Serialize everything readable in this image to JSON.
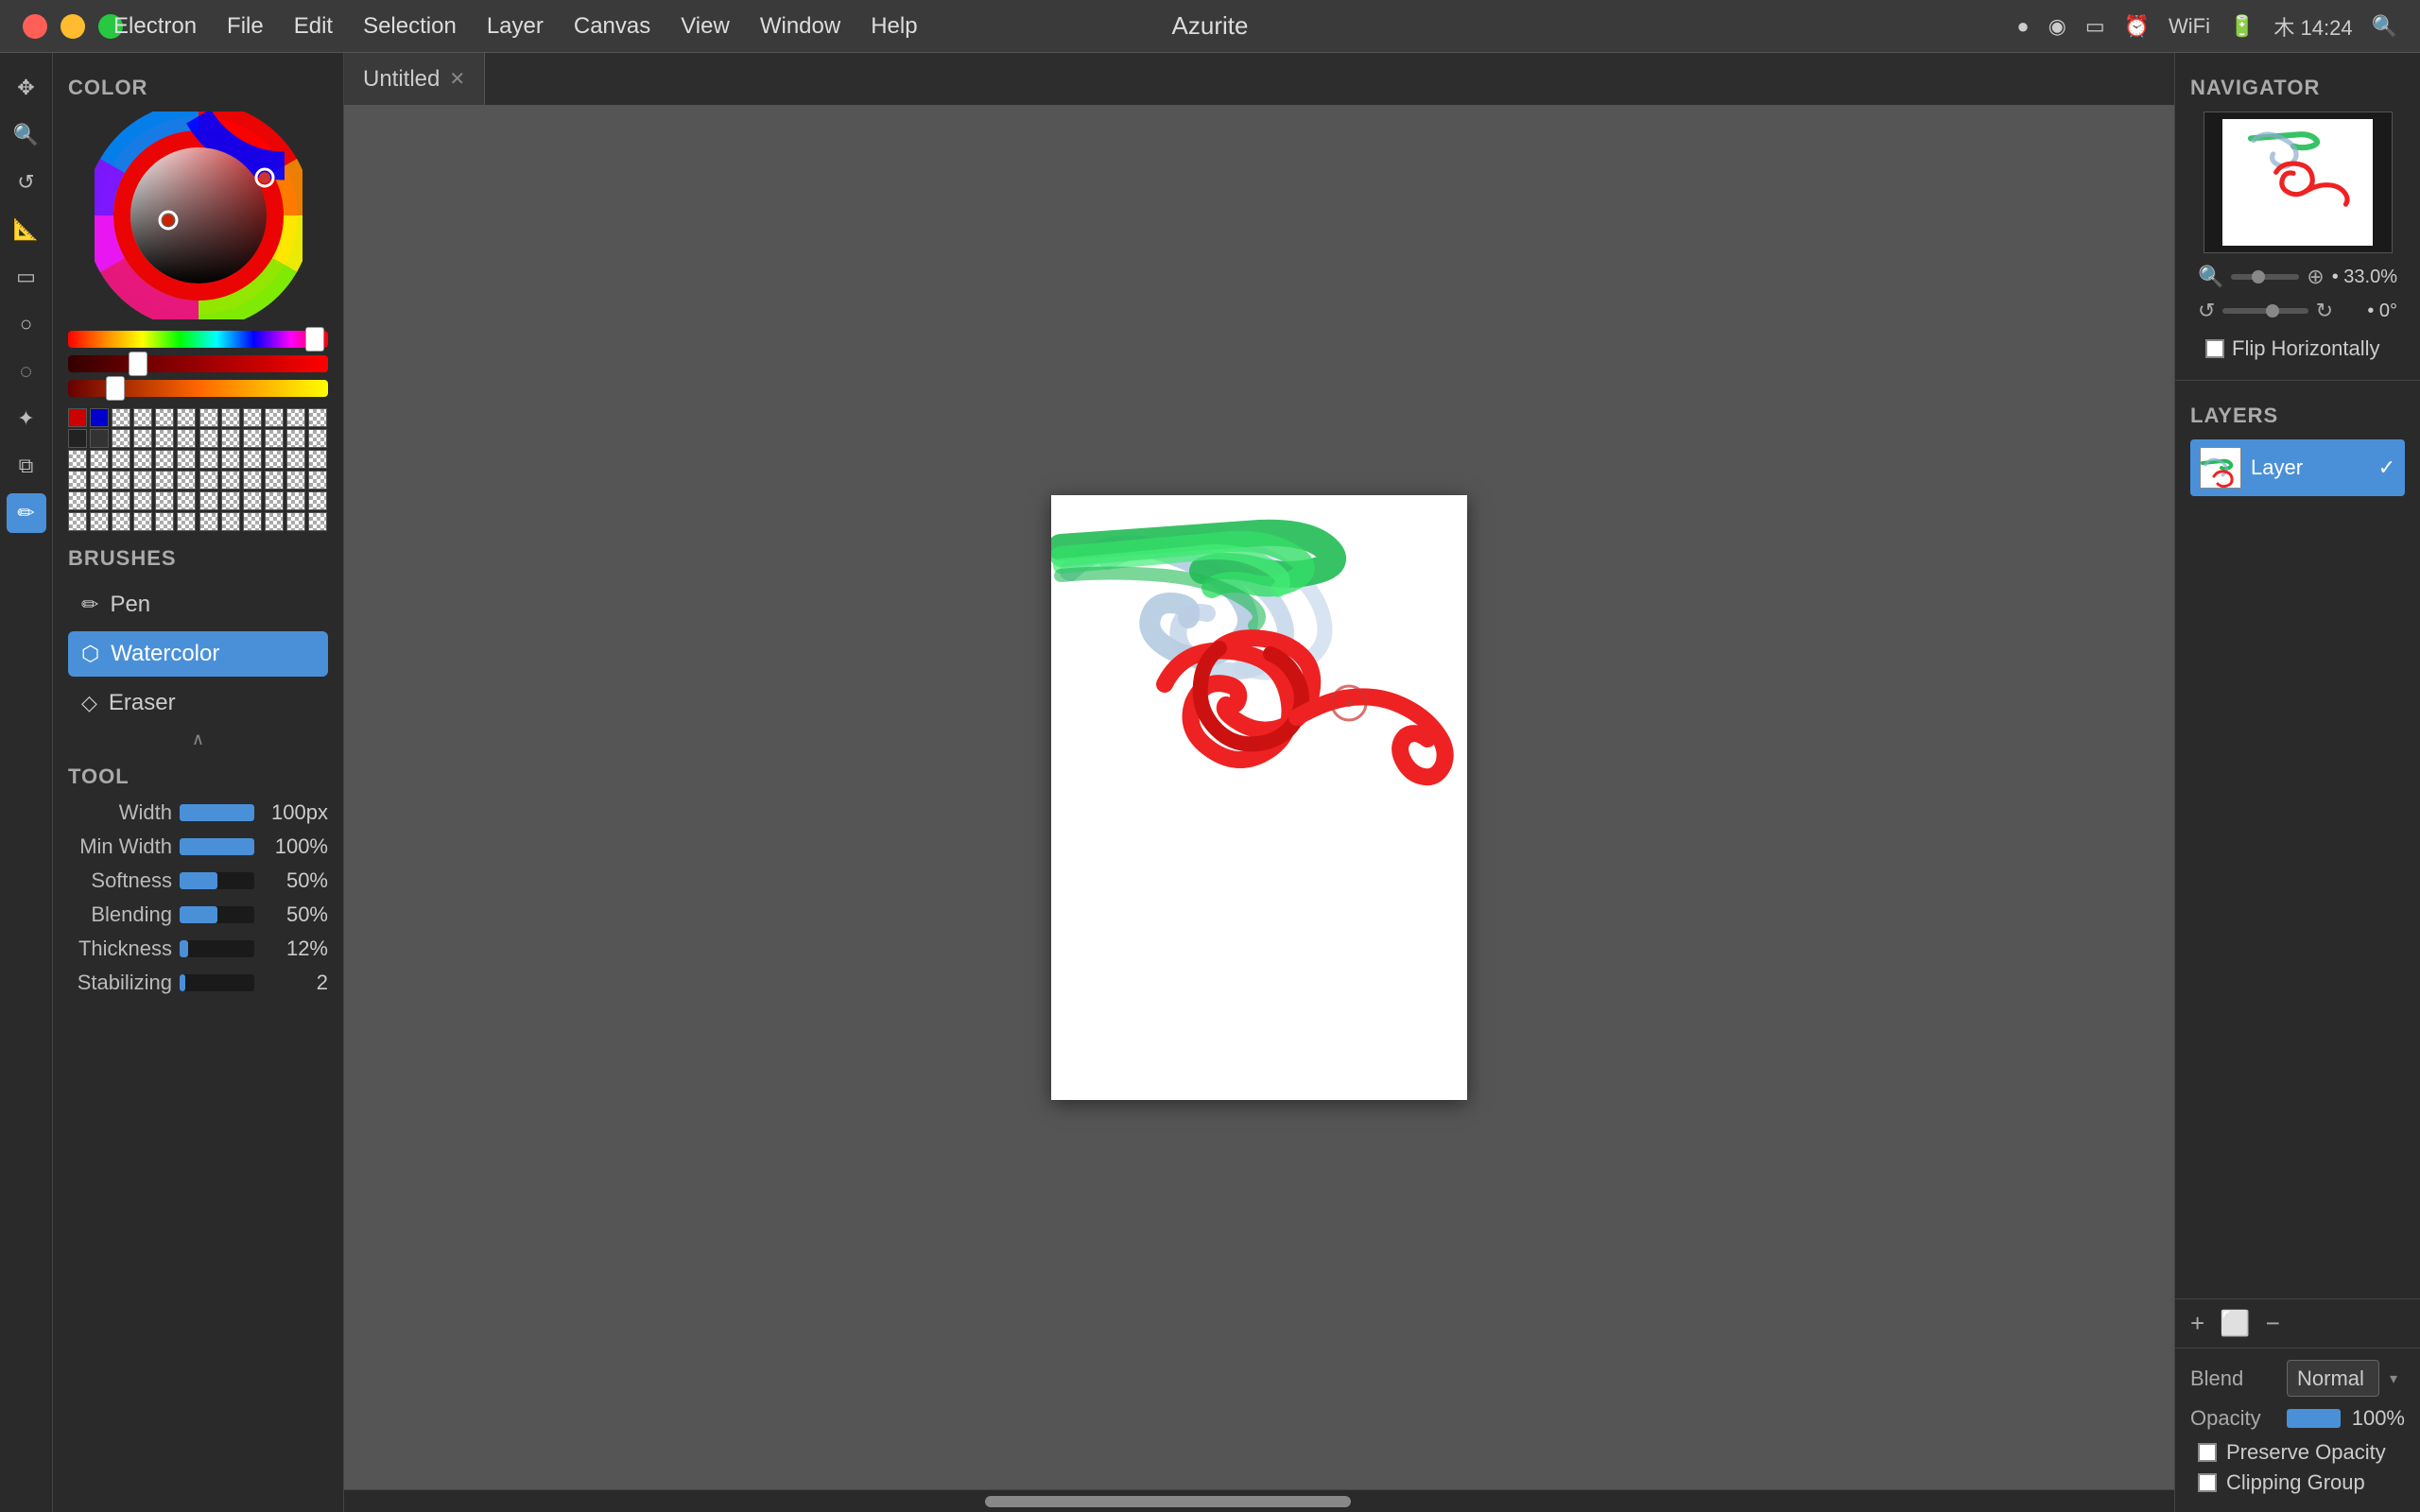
{
  "app": {
    "title": "Azurite",
    "window_title": "Azurite"
  },
  "menu": {
    "items": [
      "Electron",
      "File",
      "Edit",
      "Selection",
      "Layer",
      "Canvas",
      "View",
      "Window",
      "Help"
    ]
  },
  "time": "木 14:24",
  "left_panel": {
    "color_section_title": "COLOR",
    "brushes_section_title": "BRUSHES",
    "tool_section_title": "TOOL",
    "brushes": [
      {
        "name": "Pen",
        "icon": "✏️",
        "active": false
      },
      {
        "name": "Watercolor",
        "icon": "💧",
        "active": true
      },
      {
        "name": "Eraser",
        "icon": "◇",
        "active": false
      }
    ],
    "tool_settings": [
      {
        "label": "Width",
        "value": "100px",
        "percent": 100
      },
      {
        "label": "Min Width",
        "value": "100%",
        "percent": 100
      },
      {
        "label": "Softness",
        "value": "50%",
        "percent": 50
      },
      {
        "label": "Blending",
        "value": "50%",
        "percent": 50
      },
      {
        "label": "Thickness",
        "value": "12%",
        "percent": 12
      },
      {
        "label": "Stabilizing",
        "value": "2",
        "percent": 8
      }
    ]
  },
  "tabs": [
    {
      "name": "Untitled",
      "active": true
    }
  ],
  "navigator": {
    "section_title": "NAVIGATOR",
    "zoom_value": "33.0%",
    "rotation_value": "0°",
    "flip_label": "Flip Horizontally"
  },
  "layers": {
    "section_title": "LAYERS",
    "items": [
      {
        "name": "Layer",
        "visible": true
      }
    ],
    "add_label": "+",
    "group_label": "⬜",
    "delete_label": "−"
  },
  "blend": {
    "blend_label": "Blend",
    "blend_value": "Normal",
    "opacity_label": "Opacity",
    "opacity_value": "100%",
    "preserve_opacity_label": "Preserve Opacity",
    "clipping_group_label": "Clipping Group"
  },
  "swatches": {
    "colors": [
      "#cc0000",
      "#0000cc",
      "#cccccc",
      "#aaaaaa",
      "#888888",
      "#666666",
      "#444444",
      "#222222",
      "#111111",
      "#000000",
      "#eeeeee",
      "#ffffff",
      "#eeeeee",
      "#dddddd",
      "#cccccc",
      "#bbbbbb",
      "#aaaaaa",
      "#999999",
      "#888888",
      "#777777",
      "#666666",
      "#555555",
      "#444444",
      "#333333",
      "#eeeeee",
      "#dddddd",
      "#cccccc",
      "#bbbbbb",
      "#aaaaaa",
      "#999999",
      "#888888",
      "#777777",
      "#666666",
      "#555555",
      "#444444",
      "#333333",
      "#eeeeee",
      "#dddddd",
      "#cccccc",
      "#bbbbbb",
      "#aaaaaa",
      "#999999",
      "#888888",
      "#777777",
      "#666666",
      "#555555",
      "#444444",
      "#333333",
      "#eeeeee",
      "#dddddd",
      "#cccccc",
      "#bbbbbb",
      "#aaaaaa",
      "#999999",
      "#888888",
      "#777777",
      "#666666",
      "#555555",
      "#444444",
      "#333333",
      "#eeeeee",
      "#dddddd",
      "#cccccc",
      "#bbbbbb",
      "#aaaaaa",
      "#999999",
      "#888888",
      "#777777",
      "#666666",
      "#555555",
      "#444444",
      "#333333"
    ]
  }
}
